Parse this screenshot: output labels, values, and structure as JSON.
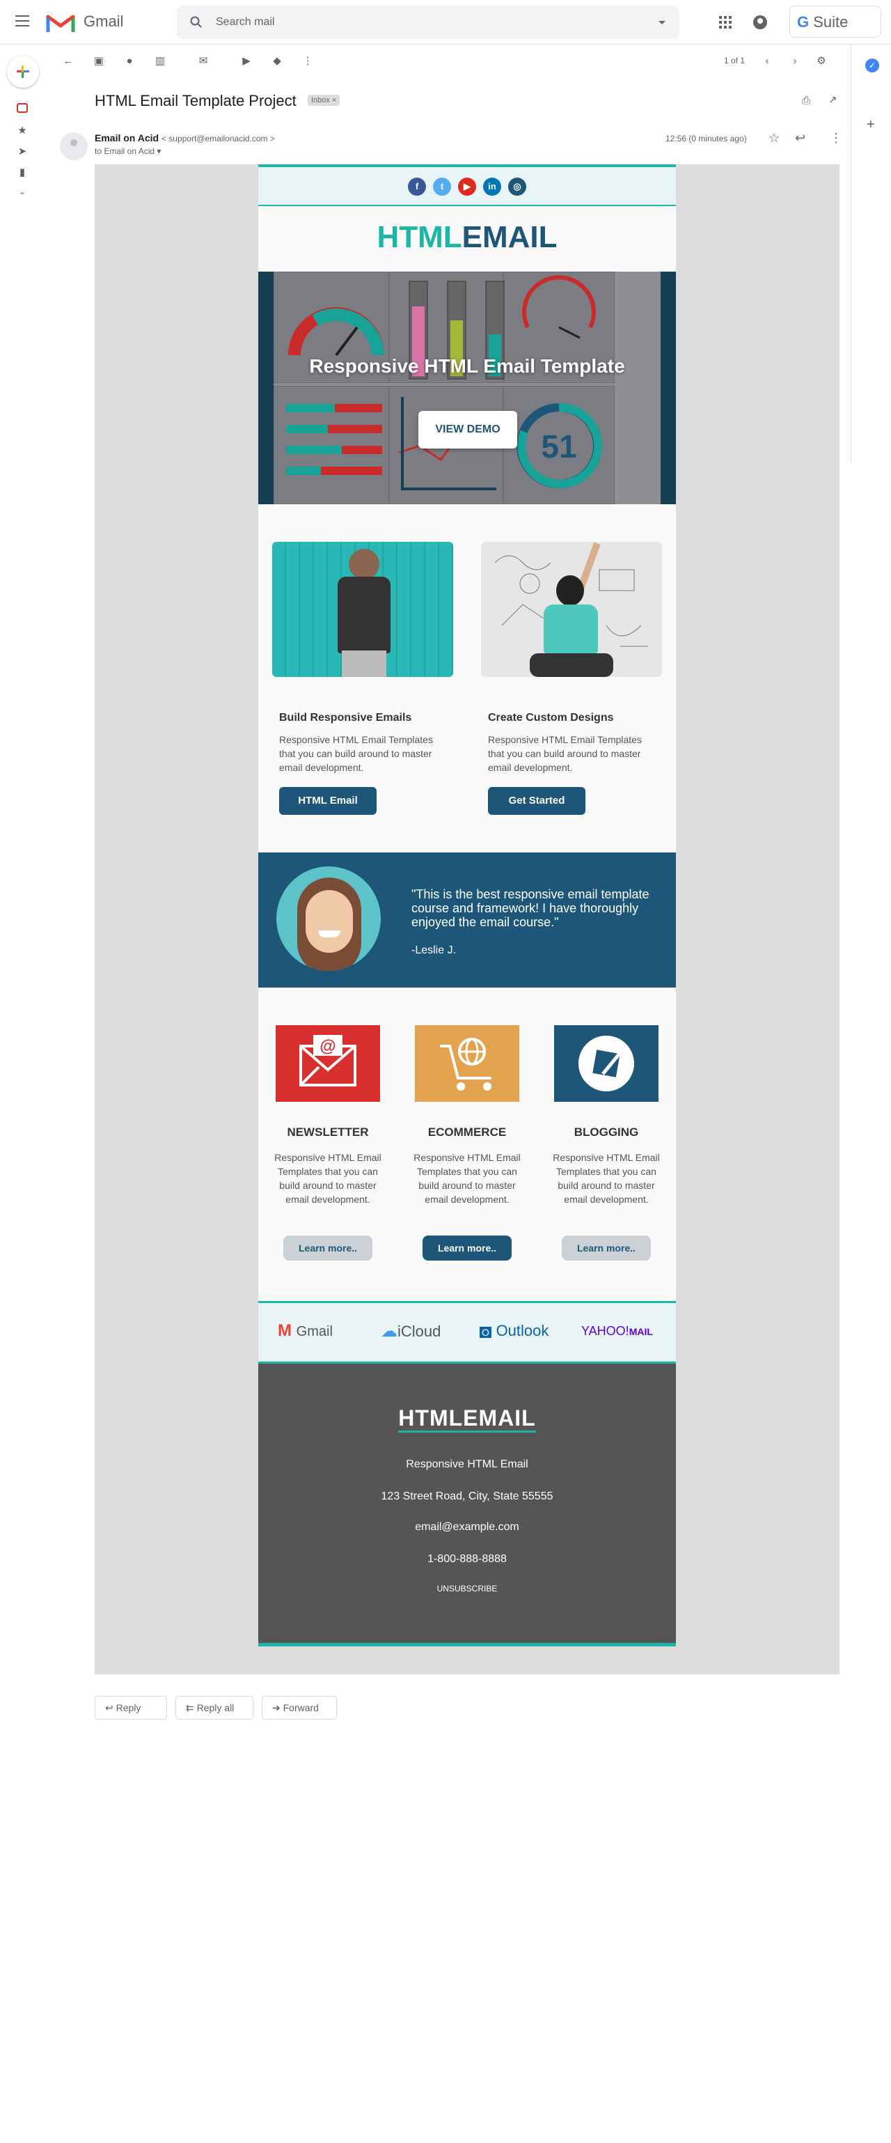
{
  "header": {
    "app_name": "Gmail",
    "search_placeholder": "Search mail",
    "suite_label": "Suite"
  },
  "toolbar": {
    "pager": "1 of 1"
  },
  "message": {
    "subject": "HTML Email Template Project",
    "label": "Inbox",
    "sender_name": "Email on Acid",
    "sender_email": "< support@emailonacid.com >",
    "to_line": "to Email on Acid",
    "time": "12:56 (0 minutes ago)"
  },
  "email": {
    "logo_a": "HTML",
    "logo_b": "EMAIL",
    "hero_title": "Responsive HTML Email Template",
    "hero_gauge": "51",
    "hero_button": "VIEW DEMO",
    "cols": [
      {
        "title": "Build Responsive Emails",
        "text": "Responsive HTML Email Templates that you can build around to master email development.",
        "button": "HTML Email"
      },
      {
        "title": "Create Custom Designs",
        "text": "Responsive HTML Email Templates that you can build around to master email development.",
        "button": "Get Started"
      }
    ],
    "testimonial": {
      "quote": "\"This is the best responsive email template course and framework! I have thoroughly enjoyed the email course.\"",
      "author": "-Leslie J."
    },
    "features": [
      {
        "title": "NEWSLETTER",
        "text": "Responsive HTML Email Templates that you can build around to master email development.",
        "button": "Learn more..",
        "color": "#d92f2f"
      },
      {
        "title": "ECOMMERCE",
        "text": "Responsive HTML Email Templates that you can build around to master email development.",
        "button": "Learn more..",
        "color": "#e2a24e"
      },
      {
        "title": "BLOGGING",
        "text": "Responsive HTML Email Templates that you can build around to master email development.",
        "button": "Learn more..",
        "color": "#1d5678"
      }
    ],
    "clients": {
      "gmail": "Gmail",
      "icloud": "iCloud",
      "outlook": "Outlook",
      "yahoo": "YAHOO!",
      "yahoo_mail": "MAIL"
    },
    "footer": {
      "logo": "HTMLEMAIL",
      "tagline": "Responsive HTML Email",
      "address": "123 Street Road, City, State 55555",
      "email": "email@example.com",
      "phone": "1-800-888-8888",
      "unsubscribe": "UNSUBSCRIBE"
    }
  },
  "actions": {
    "reply": "Reply",
    "reply_all": "Reply all",
    "forward": "Forward"
  },
  "colors": {
    "teal": "#1bb6a6",
    "navy": "#1d5678",
    "footer_bg": "#555555"
  }
}
